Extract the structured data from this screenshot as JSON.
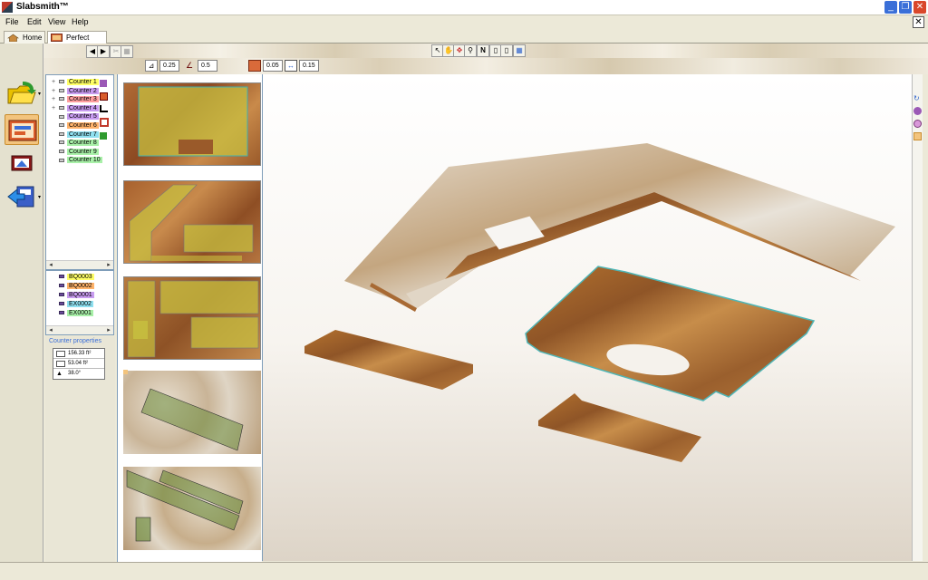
{
  "window": {
    "title": "Slabsmith™"
  },
  "menu": [
    "File",
    "Edit",
    "View",
    "Help"
  ],
  "tabs": [
    {
      "label": "Home",
      "active": false
    },
    {
      "label": "Perfect Match",
      "active": true
    }
  ],
  "params": {
    "value1": "0.25",
    "value2": "0.5",
    "value3": "0.05",
    "value4": "0.15"
  },
  "counters": [
    {
      "label": "Counter 1",
      "color": "#ffff66"
    },
    {
      "label": "Counter 2",
      "color": "#c89cf0"
    },
    {
      "label": "Counter 3",
      "color": "#ff9f9f"
    },
    {
      "label": "Counter 4",
      "color": "#c89cf0"
    },
    {
      "label": "Counter 5",
      "color": "#c89cf0"
    },
    {
      "label": "Counter 6",
      "color": "#ffb36a"
    },
    {
      "label": "Counter 7",
      "color": "#8fe0f0"
    },
    {
      "label": "Counter 8",
      "color": "#a8f0a8"
    },
    {
      "label": "Counter 9",
      "color": "#a8f0a8"
    },
    {
      "label": "Counter 10",
      "color": "#a8f0a8"
    }
  ],
  "slabs_list": [
    {
      "label": "BQ0003",
      "color": "#ffff66"
    },
    {
      "label": "BQ0002",
      "color": "#ffb36a"
    },
    {
      "label": "BQ0001",
      "color": "#c89cf0"
    },
    {
      "label": "EX0002",
      "color": "#8fe0f0"
    },
    {
      "label": "EX0001",
      "color": "#a8f0a8"
    }
  ],
  "properties": {
    "title": "Counter properties",
    "area1": "156.33 ft²",
    "area2": "53.04 ft²",
    "angle": "38.0°"
  }
}
